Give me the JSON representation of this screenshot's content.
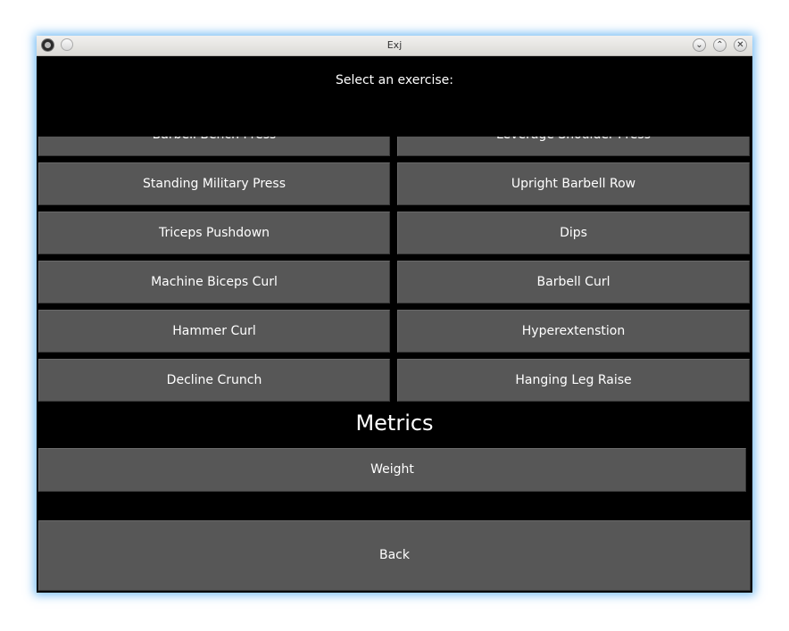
{
  "window": {
    "title": "Exj",
    "controls": {
      "minimize_icon": "chevron-down-icon",
      "maximize_icon": "chevron-up-icon",
      "close_icon": "close-icon",
      "minimize_glyph": "⌄",
      "maximize_glyph": "⌃",
      "close_glyph": "✕"
    }
  },
  "header": {
    "label": "Select an exercise:"
  },
  "exercises": {
    "left": [
      "Barbell Bench Press",
      "Standing Military Press",
      "Triceps Pushdown",
      "Machine Biceps Curl",
      "Hammer Curl",
      "Decline Crunch"
    ],
    "right": [
      "Leverage Shoulder Press",
      "Upright Barbell Row",
      "Dips",
      "Barbell Curl",
      "Hyperextenstion",
      "Hanging Leg Raise"
    ]
  },
  "metrics": {
    "title": "Metrics",
    "weight_label": "Weight"
  },
  "footer": {
    "back_label": "Back"
  },
  "colors": {
    "background": "#000000",
    "button": "#575757",
    "text": "#ffffff",
    "window_glow": "#50aaf0"
  }
}
